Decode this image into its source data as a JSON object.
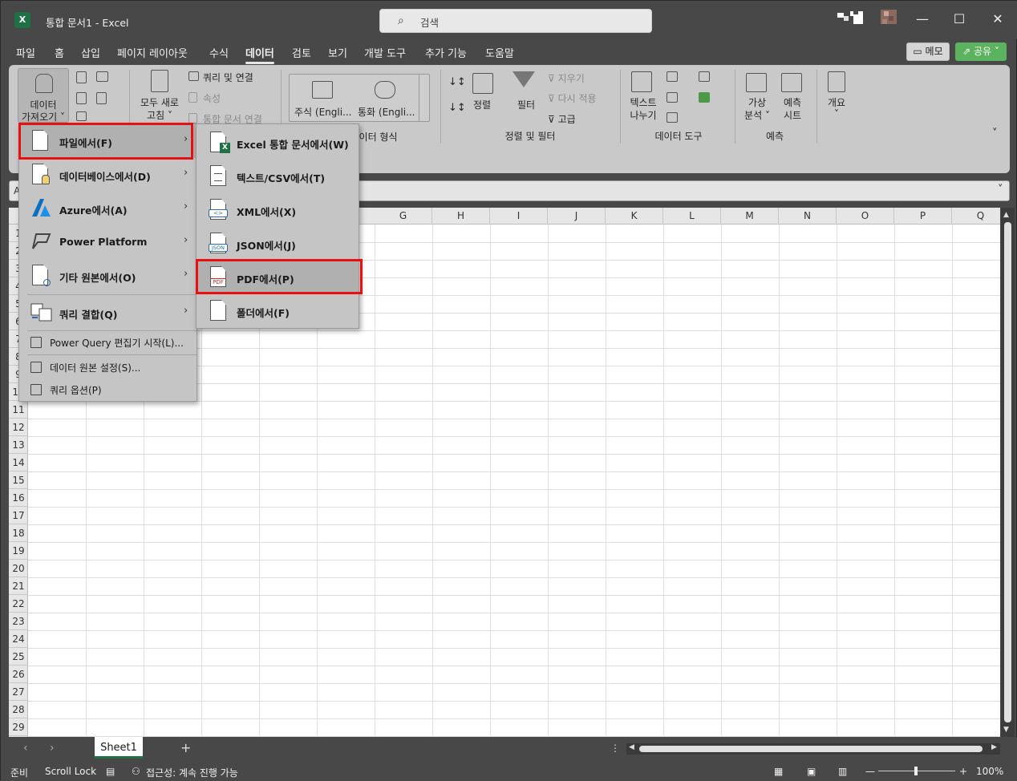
{
  "titlebar": {
    "title": "통합 문서1  -  Excel",
    "search_placeholder": "검색",
    "app_icon": "X"
  },
  "menu_tabs": [
    "파일",
    "홈",
    "삽입",
    "페이지 레이아웃",
    "수식",
    "데이터",
    "검토",
    "보기",
    "개발 도구",
    "추가 기능",
    "도움말"
  ],
  "active_tab": "데이터",
  "memo_label": "메모",
  "share_label": "공유",
  "ribbon": {
    "get_data": [
      "데이터",
      "가져오기 ˅"
    ],
    "refresh_all": [
      "모두 새로",
      "고침 ˅"
    ],
    "queries_connections": "쿼리 및 연결",
    "properties": "속성",
    "edit_links": "통합 문서 연결",
    "stocks": "주식 (Engli...",
    "currencies": "통화 (Engli...",
    "data_types_group": "데이터 형식",
    "sort": "정렬",
    "filter": "필터",
    "clear": "지우기",
    "reapply": "다시 적용",
    "advanced": "고급",
    "sort_filter_group": "정렬 및 필터",
    "text_to_columns": [
      "텍스트",
      "나누기"
    ],
    "data_tools_group": "데이터 도구",
    "what_if": [
      "가상",
      "분석 ˅"
    ],
    "forecast_sheet": [
      "예측",
      "시트"
    ],
    "forecast_group": "예측",
    "outline": "개요"
  },
  "get_data_menu": {
    "items": [
      {
        "label": "파일에서(F)",
        "icon": "file-icon"
      },
      {
        "label": "데이터베이스에서(D)",
        "icon": "database-icon"
      },
      {
        "label": "Azure에서(A)",
        "icon": "azure-icon"
      },
      {
        "label": "Power Platform",
        "icon": "power-platform-icon"
      },
      {
        "label": "기타 원본에서(O)",
        "icon": "other-sources-icon"
      },
      {
        "label": "쿼리 결합(Q)",
        "icon": "combine-queries-icon"
      }
    ],
    "small_items": [
      {
        "label": "Power Query 편집기 시작(L)...",
        "icon": "power-query-icon"
      },
      {
        "label": "데이터 원본 설정(S)...",
        "icon": "data-source-settings-icon"
      },
      {
        "label": "쿼리 옵션(P)",
        "icon": "query-options-icon"
      }
    ]
  },
  "from_file_submenu": {
    "items": [
      {
        "label": "Excel 통합 문서에서(W)",
        "icon": "excel-workbook-icon"
      },
      {
        "label": "텍스트/CSV에서(T)",
        "icon": "text-csv-icon"
      },
      {
        "label": "XML에서(X)",
        "icon": "xml-icon",
        "badge": "<>"
      },
      {
        "label": "JSON에서(J)",
        "icon": "json-icon",
        "badge": "JSON"
      },
      {
        "label": "PDF에서(P)",
        "icon": "pdf-icon",
        "badge": "PDF"
      },
      {
        "label": "폴더에서(F)",
        "icon": "folder-icon"
      }
    ]
  },
  "highlight_color": "#e81010",
  "grid": {
    "name_box_prefix": "A",
    "columns": [
      "G",
      "H",
      "I",
      "J",
      "K",
      "L",
      "M",
      "N",
      "O",
      "P",
      "Q"
    ],
    "rows": [
      "1",
      "2",
      "3",
      "4",
      "5",
      "6",
      "7",
      "8",
      "9",
      "10",
      "11",
      "12",
      "13",
      "14",
      "15",
      "16",
      "17",
      "18",
      "19",
      "20",
      "21",
      "22",
      "23",
      "24",
      "25",
      "26",
      "27",
      "28",
      "29"
    ]
  },
  "sheet_tabs": [
    "Sheet1"
  ],
  "add_sheet": "+",
  "statusbar": {
    "ready": "준비",
    "scroll_lock": "Scroll Lock",
    "accessibility": "접근성: 계속 진행 가능",
    "zoom": "100%"
  }
}
